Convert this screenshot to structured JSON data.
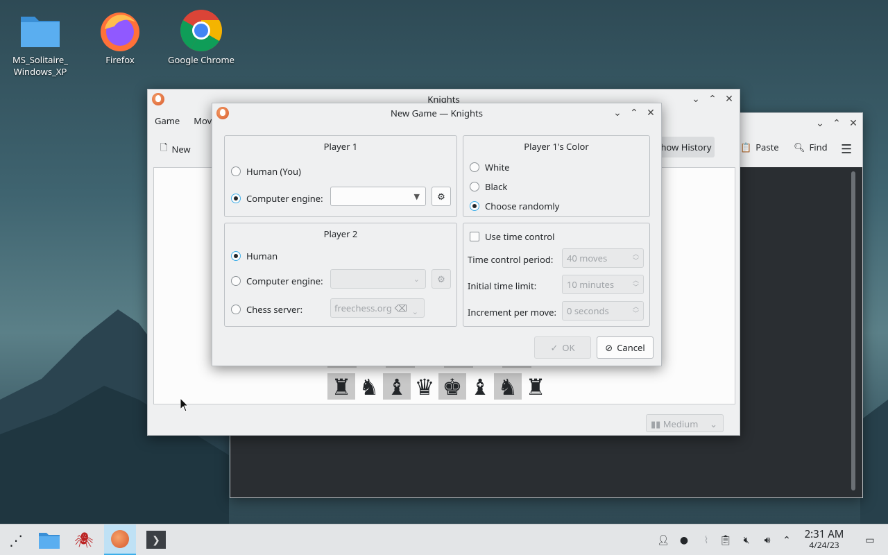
{
  "desktop": {
    "icons": [
      {
        "label": "MS_Solitaire_\nWindows_XP"
      },
      {
        "label": "Firefox"
      },
      {
        "label": "Google Chrome"
      }
    ]
  },
  "knights_window": {
    "title": "Knights",
    "menu": [
      "Game",
      "Mov"
    ],
    "toolbar_new": "New",
    "toolbar_show_history": "how History",
    "difficulty": "Medium",
    "pieces": [
      "♜",
      "♞",
      "♝",
      "♛",
      "♚",
      "♝",
      "♞",
      "♜"
    ]
  },
  "back_window": {
    "paste": "Paste",
    "find": "Find"
  },
  "dialog": {
    "title": "New Game — Knights",
    "player1": {
      "title": "Player 1",
      "human": "Human (You)",
      "engine": "Computer engine:",
      "selected": "engine"
    },
    "player1_color": {
      "title": "Player 1's Color",
      "options": [
        "White",
        "Black",
        "Choose randomly"
      ],
      "selected": "Choose randomly"
    },
    "player2": {
      "title": "Player 2",
      "human": "Human",
      "engine": "Computer engine:",
      "server": "Chess server:",
      "server_value": "freechess.org",
      "selected": "human"
    },
    "time": {
      "use_label": "Use time control",
      "period_label": "Time control period:",
      "period_value": "40 moves",
      "initial_label": "Initial time limit:",
      "initial_value": "10 minutes",
      "increment_label": "Increment per move:",
      "increment_value": "0 seconds"
    },
    "ok": "OK",
    "cancel": "Cancel"
  },
  "taskbar": {
    "time": "2:31 AM",
    "date": "4/24/23"
  },
  "colors": {
    "accent": "#3daee9",
    "panel": "#eff0f1"
  }
}
